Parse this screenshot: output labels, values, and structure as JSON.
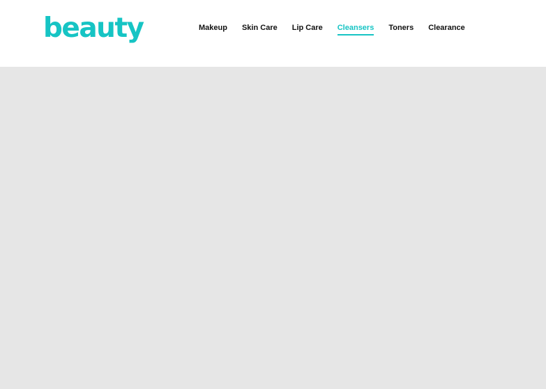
{
  "brand": {
    "name": "beauty",
    "color": "#16c4c4"
  },
  "nav": {
    "items": [
      {
        "label": "Makeup",
        "active": false
      },
      {
        "label": "Skin Care",
        "active": false
      },
      {
        "label": "Lip Care",
        "active": false
      },
      {
        "label": "Cleansers",
        "active": true
      },
      {
        "label": "Toners",
        "active": false
      },
      {
        "label": "Clearance",
        "active": false
      }
    ]
  },
  "colors": {
    "accent": "#16c4c4",
    "nav_text": "#111111",
    "content_background": "#e6e6e6",
    "header_background": "#ffffff"
  }
}
